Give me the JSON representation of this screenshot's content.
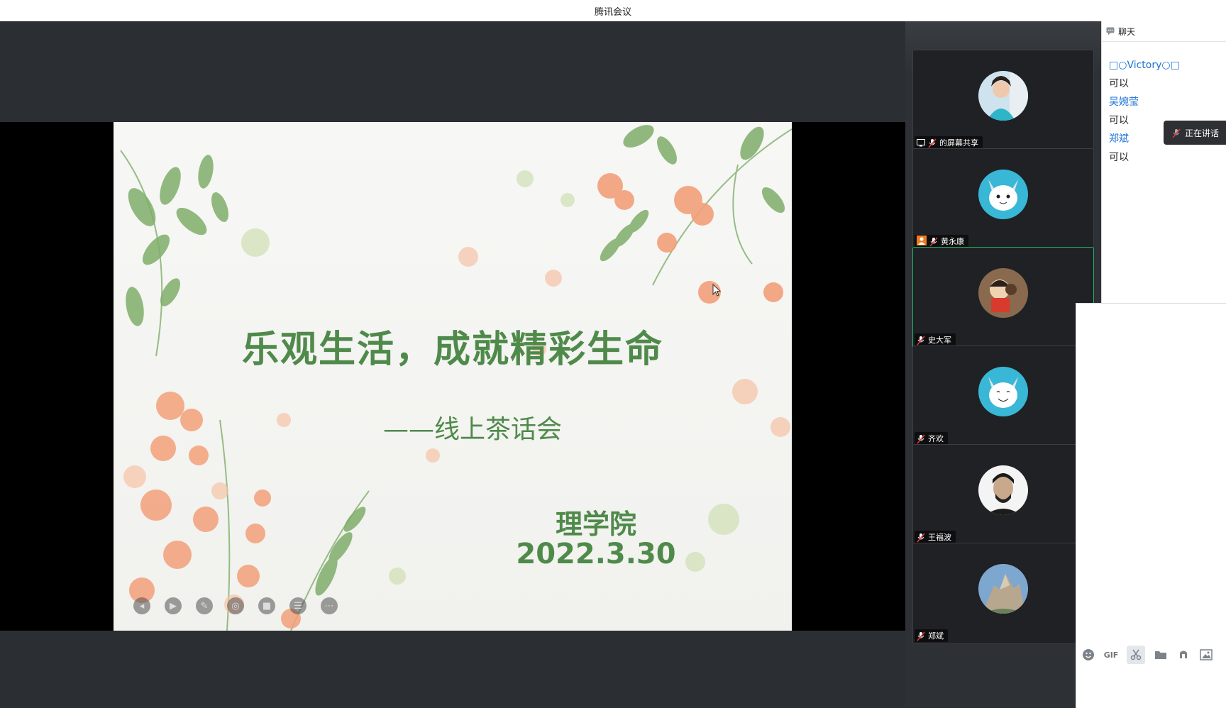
{
  "window": {
    "title": "腾讯会议"
  },
  "slide": {
    "title": "乐观生活，成就精彩生命",
    "subtitle": "——线上茶话会",
    "organization": "理学院",
    "date": "2022.3.30",
    "accent_color": "#4f8a4a",
    "controls": [
      "back-icon",
      "play-icon",
      "pen-icon",
      "screenshot-icon",
      "camera-icon",
      "caption-icon",
      "more-icon"
    ]
  },
  "participants": [
    {
      "name": "的屏幕共享",
      "role": "screen-share",
      "avatar": "woman-portrait"
    },
    {
      "name": "黄永康",
      "role": "host",
      "avatar": "cartoon-dog"
    },
    {
      "name": "史大军",
      "role": "speaking",
      "avatar": "cartoon-boy"
    },
    {
      "name": "齐欢",
      "role": "member",
      "avatar": "cartoon-dog"
    },
    {
      "name": "王福波",
      "role": "member",
      "avatar": "man-portrait"
    },
    {
      "name": "郑斌",
      "role": "member",
      "avatar": "mountain"
    }
  ],
  "chat": {
    "header": "聊天",
    "messages": [
      {
        "sender": "□○Victory○□",
        "text": "可以"
      },
      {
        "sender": "吴婉莹",
        "text": "可以"
      },
      {
        "sender": "郑斌",
        "text": "可以"
      }
    ],
    "speaking_label": "正在讲话",
    "toolbar": [
      "emoji-icon",
      "GIF",
      "scissors-icon",
      "folder-icon",
      "music-icon",
      "image-icon"
    ],
    "toolbar_gif": "GIF"
  }
}
